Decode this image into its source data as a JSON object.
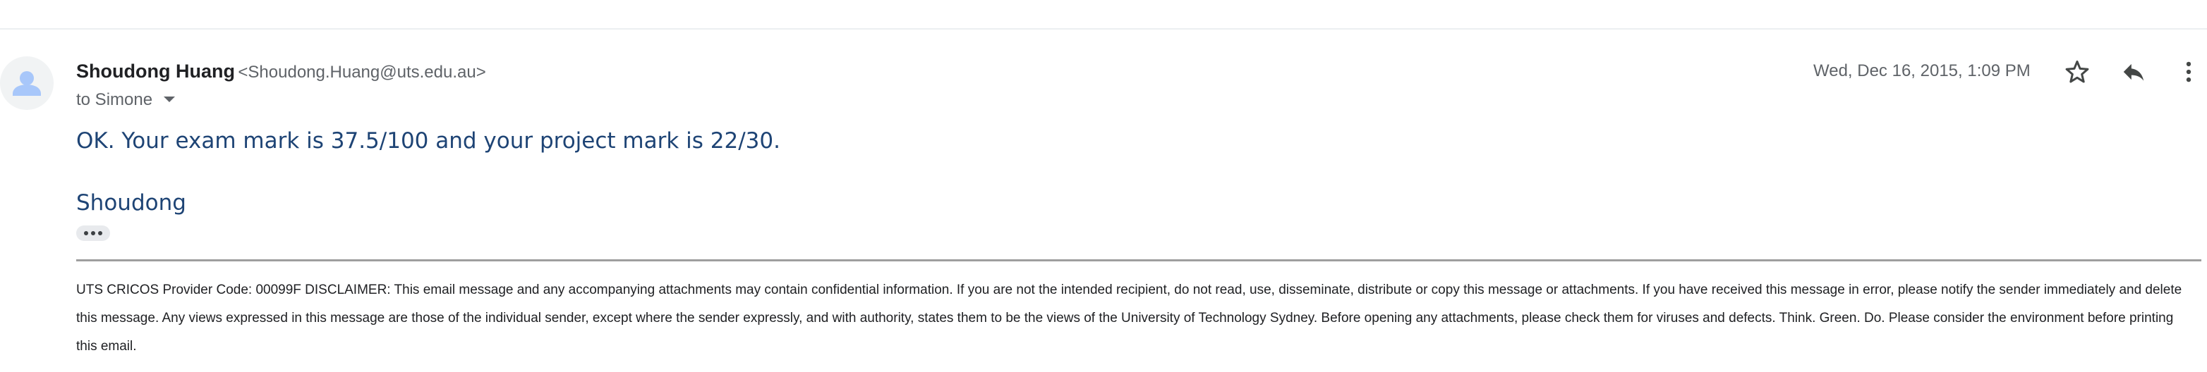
{
  "message": {
    "sender": {
      "name": "Shoudong Huang",
      "email": "<Shoudong.Huang@uts.edu.au>"
    },
    "recipient_label": "to Simone",
    "timestamp": "Wed, Dec 16, 2015, 1:09 PM",
    "body": [
      "OK. Your exam mark is 37.5/100 and your project mark is 22/30.",
      "Shoudong"
    ],
    "disclaimer": "UTS CRICOS Provider Code: 00099F DISCLAIMER: This email message and any accompanying attachments may contain confidential information. If you are not the intended recipient, do not read, use, disseminate, distribute or copy this message or attachments. If you have received this message in error, please notify the sender immediately and delete this message. Any views expressed in this message are those of the individual sender, except where the sender expressly, and with authority, states them to be the views of the University of Technology Sydney. Before opening any attachments, please check them for viruses and defects. Think. Green. Do. Please consider the environment before printing this email."
  },
  "icons": {
    "avatar": "person-icon",
    "details_toggle": "caret-down-icon",
    "star": "star-icon",
    "reply": "reply-icon",
    "more": "more-vert-icon",
    "trimmed_content": "ellipsis-icon"
  },
  "colors": {
    "sender_name": "#202124",
    "secondary_text": "#5f6368",
    "body_text": "#1e4475",
    "avatar_bg": "#f1f3f4",
    "avatar_glyph": "#a8c7fa"
  }
}
